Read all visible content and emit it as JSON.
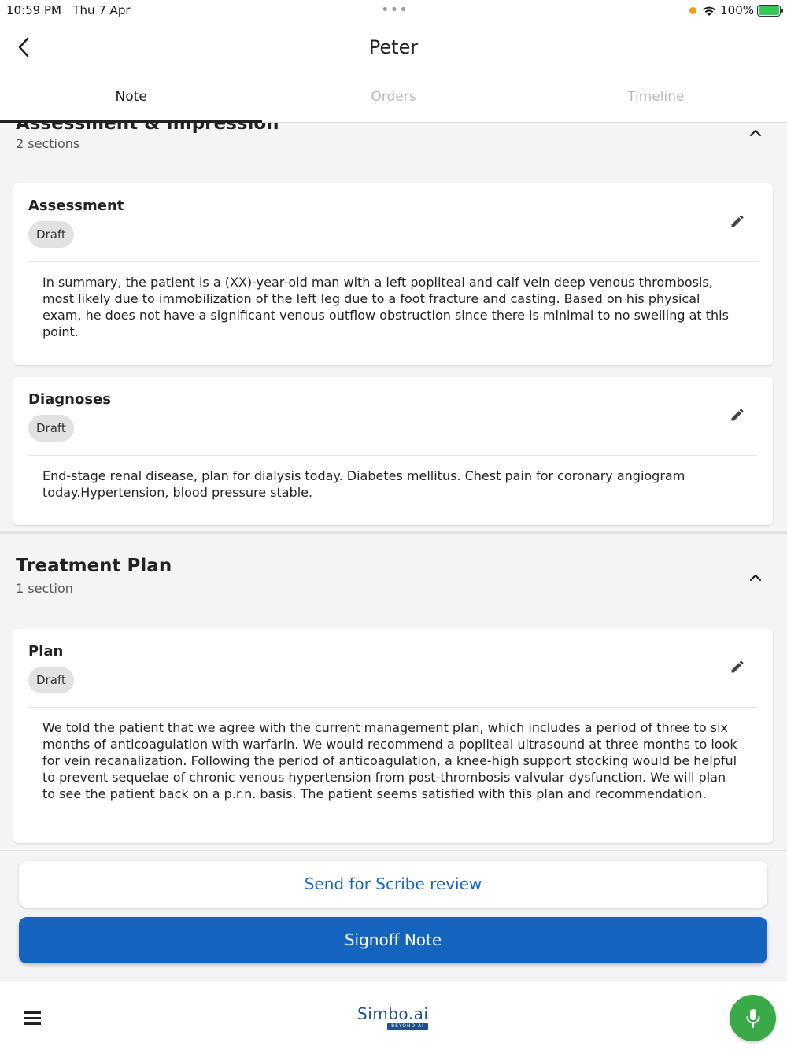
{
  "status_bar": {
    "time": "10:59 PM",
    "date": "Thu 7 Apr",
    "dots": "•••",
    "battery": "100%"
  },
  "header": {
    "title": "Peter",
    "back_icon": "chevron-left-icon"
  },
  "tabs": [
    {
      "label": "Note",
      "active": true
    },
    {
      "label": "Orders",
      "active": false
    },
    {
      "label": "Timeline",
      "active": false
    }
  ],
  "sections": [
    {
      "title": "Assessment & Impression",
      "count": "2 sections",
      "cards": [
        {
          "title": "Assessment",
          "badge": "Draft",
          "body": "In summary, the patient is a (XX)-year-old man with a left popliteal and calf vein deep venous thrombosis, most likely due to immobilization of the left leg due to a foot fracture and casting. Based on his physical exam, he does not have a significant venous outflow obstruction since there is minimal to no swelling at this point."
        },
        {
          "title": "Diagnoses",
          "badge": "Draft",
          "body": "End-stage renal disease, plan for dialysis today. Diabetes mellitus. Chest pain for coronary angiogram today.Hypertension, blood pressure stable."
        }
      ]
    },
    {
      "title": "Treatment Plan",
      "count": "1 section",
      "cards": [
        {
          "title": "Plan",
          "badge": "Draft",
          "body": "We told the patient that we agree with the current management plan, which includes a period of three to six months of anticoagulation with warfarin. We would recommend a popliteal ultrasound at three months to look for vein recanalization. Following the period of anticoagulation, a knee-high support stocking would be helpful to prevent sequelae of chronic venous hypertension from post-thrombosis valvular dysfunction. We will plan to see the patient back on a p.r.n. basis. The patient seems satisfied with this plan and recommendation."
        }
      ]
    }
  ],
  "actions": {
    "scribe_label": "Send for Scribe review",
    "signoff_label": "Signoff Note"
  },
  "bottom_bar": {
    "logo_text": "Simbo.ai",
    "logo_sub": "BEYOND AI",
    "menu_icon": "hamburger-menu-icon",
    "mic_icon": "microphone-icon"
  },
  "colors": {
    "primary": "#1565c0",
    "mic": "#3aaa48",
    "badge_bg": "#e2e2e4",
    "content_bg": "#f4f4f6"
  }
}
